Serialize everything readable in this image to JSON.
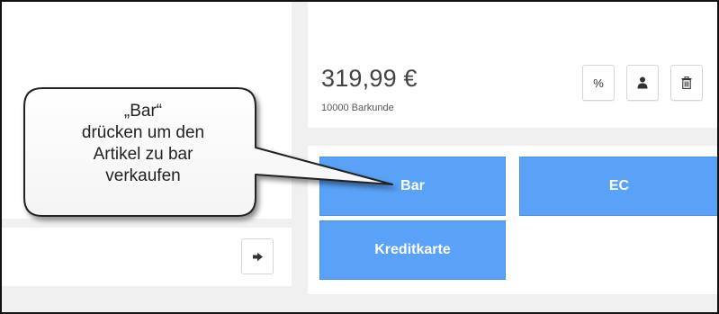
{
  "summary": {
    "price": "319,99 €",
    "customer": "10000 Barkunde"
  },
  "toolbar": {
    "percent_label": "%"
  },
  "payment": {
    "bar_label": "Bar",
    "ec_label": "EC",
    "kreditkarte_label": "Kreditkarte"
  },
  "callout": {
    "line1": "„Bar“",
    "line2": "drücken um den",
    "line3": "Artikel zu bar",
    "line4": "verkaufen"
  },
  "icons": {
    "user": "user-icon",
    "trash": "trash-icon",
    "exit": "sign-out-icon"
  },
  "colors": {
    "payment_button": "#59a2f7",
    "background": "#f0f0f0"
  }
}
